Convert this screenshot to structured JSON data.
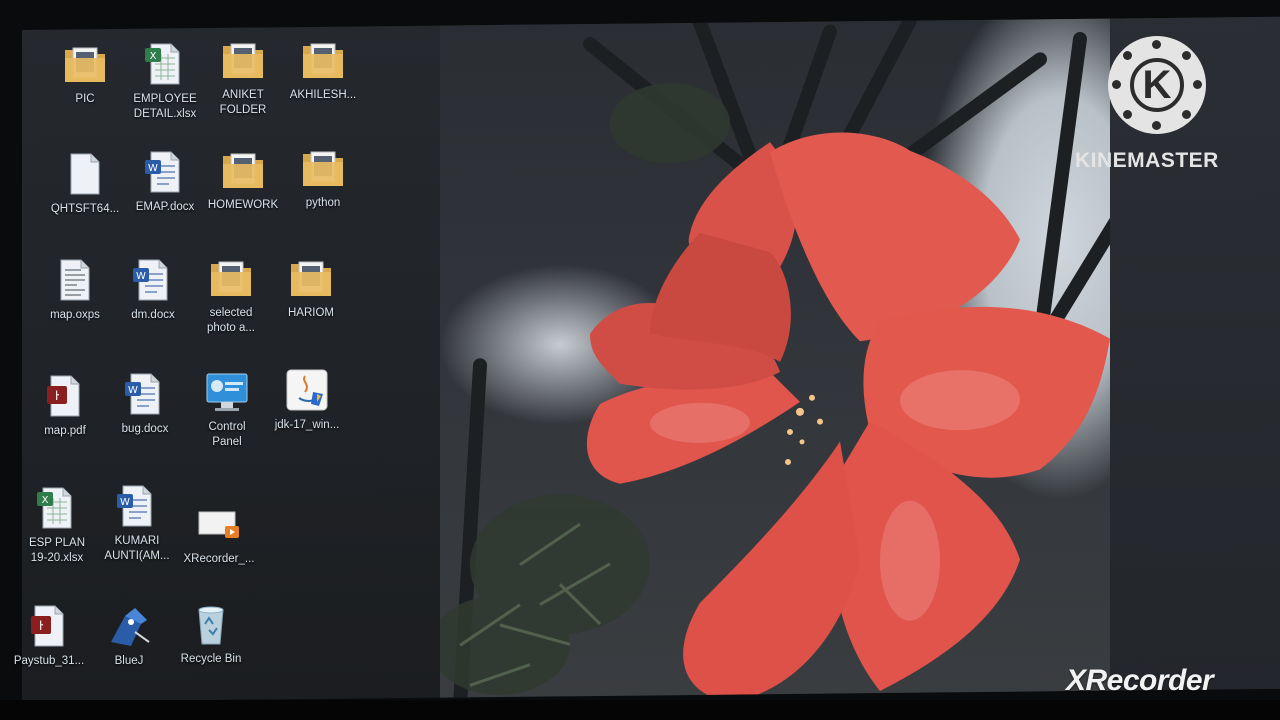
{
  "desktop": {
    "icons": [
      {
        "label": "PIC",
        "type": "folder"
      },
      {
        "label": "EMPLOYEE\nDETAIL.xlsx",
        "type": "excel"
      },
      {
        "label": "ANIKET\nFOLDER",
        "type": "folder"
      },
      {
        "label": "AKHILESH...",
        "type": "folder"
      },
      {
        "label": "QHTSFT64...",
        "type": "blank-file"
      },
      {
        "label": "EMAP.docx",
        "type": "word"
      },
      {
        "label": "HOMEWORK",
        "type": "folder"
      },
      {
        "label": "python",
        "type": "folder"
      },
      {
        "label": "map.oxps",
        "type": "xps"
      },
      {
        "label": "dm.docx",
        "type": "word"
      },
      {
        "label": "selected\nphoto a...",
        "type": "folder"
      },
      {
        "label": "HARIOM",
        "type": "folder"
      },
      {
        "label": "map.pdf",
        "type": "pdf"
      },
      {
        "label": "bug.docx",
        "type": "word"
      },
      {
        "label": "Control\nPanel",
        "type": "control-panel"
      },
      {
        "label": "jdk-17_win...",
        "type": "java"
      },
      {
        "label": "ESP PLAN\n19-20.xlsx",
        "type": "excel"
      },
      {
        "label": "KUMARI\nAUNTI(AM...",
        "type": "word"
      },
      {
        "label": "XRecorder_...",
        "type": "video"
      },
      {
        "label": "Paystub_31...",
        "type": "pdf"
      },
      {
        "label": "BlueJ",
        "type": "bluej"
      },
      {
        "label": "Recycle Bin",
        "type": "recycle-bin"
      }
    ]
  },
  "overlays": {
    "kinemaster_logo_letter": "K",
    "kinemaster_text": "KINEMASTER",
    "xrecorder_text": "XRecorder"
  },
  "colors": {
    "flower": "#e8574e",
    "folder": "#d9a84a",
    "excel": "#2f7d4a",
    "word": "#2b5ca8",
    "pdf": "#8b1e1e"
  }
}
